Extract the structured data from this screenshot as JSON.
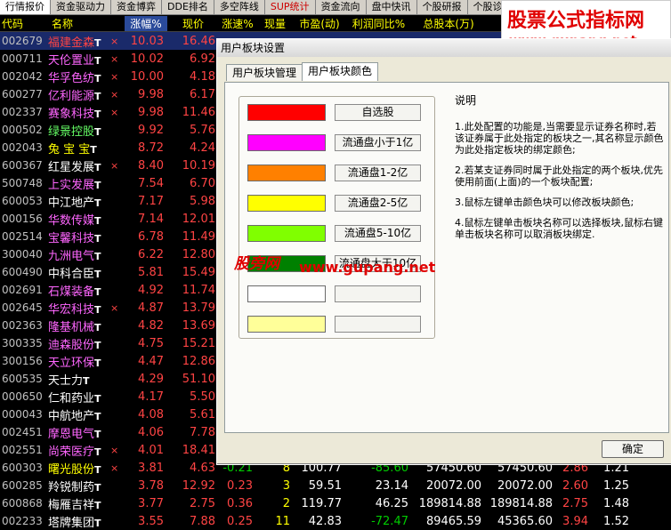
{
  "tabs": [
    "行情报价",
    "资金驱动力",
    "资金博弈",
    "DDE排名",
    "多空阵线",
    "SUP统计",
    "资金流向",
    "盘中快讯",
    "个股研报",
    "个股诊断",
    "热点聚焦"
  ],
  "columns": {
    "code": "代码",
    "name": "名称",
    "pct": "涨幅%",
    "price": "现价",
    "speed": "涨速%",
    "vol": "现量",
    "pe": "市盈(动)",
    "profit": "利润同比%",
    "total": "总股本(万)"
  },
  "rows": [
    {
      "code": "002679",
      "name": "福建金森",
      "x": "×",
      "pct": "10.03",
      "price": "16.46"
    },
    {
      "code": "000711",
      "name": "天伦置业",
      "x": "×",
      "pct": "10.02",
      "price": "6.92"
    },
    {
      "code": "002042",
      "name": "华孚色纺",
      "x": "×",
      "pct": "10.00",
      "price": "4.18"
    },
    {
      "code": "600277",
      "name": "亿利能源",
      "x": "×",
      "pct": "9.98",
      "price": "6.17"
    },
    {
      "code": "002337",
      "name": "赛象科技",
      "x": "×",
      "pct": "9.98",
      "price": "11.46"
    },
    {
      "code": "000502",
      "name": "绿景控股",
      "x": "",
      "pct": "9.92",
      "price": "5.76"
    },
    {
      "code": "002043",
      "name": "兔 宝 宝",
      "x": "",
      "pct": "8.72",
      "price": "4.24"
    },
    {
      "code": "600367",
      "name": "红星发展",
      "x": "×",
      "pct": "8.40",
      "price": "10.19"
    },
    {
      "code": "500748",
      "name": "上实发展",
      "x": "",
      "pct": "7.54",
      "price": "6.70"
    },
    {
      "code": "600053",
      "name": "中江地产",
      "x": "",
      "pct": "7.17",
      "price": "5.98"
    },
    {
      "code": "000156",
      "name": "华数传媒",
      "x": "",
      "pct": "7.14",
      "price": "12.01"
    },
    {
      "code": "002514",
      "name": "宝馨科技",
      "x": "",
      "pct": "6.78",
      "price": "11.49"
    },
    {
      "code": "300040",
      "name": "九洲电气",
      "x": "",
      "pct": "6.22",
      "price": "12.80"
    },
    {
      "code": "600490",
      "name": "中科合臣",
      "x": "",
      "pct": "5.81",
      "price": "15.49"
    },
    {
      "code": "002691",
      "name": "石煤装备",
      "x": "",
      "pct": "4.92",
      "price": "11.74"
    },
    {
      "code": "002645",
      "name": "华宏科技",
      "x": "×",
      "pct": "4.87",
      "price": "13.79"
    },
    {
      "code": "002363",
      "name": "隆基机械",
      "x": "",
      "pct": "4.82",
      "price": "13.69"
    },
    {
      "code": "300335",
      "name": "迪森股份",
      "x": "",
      "pct": "4.75",
      "price": "15.21"
    },
    {
      "code": "300156",
      "name": "天立环保",
      "x": "",
      "pct": "4.47",
      "price": "12.86"
    },
    {
      "code": "600535",
      "name": "天士力",
      "x": "",
      "pct": "4.29",
      "price": "51.10"
    },
    {
      "code": "000650",
      "name": "仁和药业",
      "x": "",
      "pct": "4.17",
      "price": "5.50"
    },
    {
      "code": "000043",
      "name": "中航地产",
      "x": "",
      "pct": "4.08",
      "price": "5.61"
    },
    {
      "code": "002451",
      "name": "摩恩电气",
      "x": "",
      "pct": "4.06",
      "price": "7.78"
    },
    {
      "code": "002551",
      "name": "尚荣医疗",
      "x": "×",
      "pct": "4.01",
      "price": "18.41"
    },
    {
      "code": "600303",
      "name": "曙光股份",
      "x": "×",
      "pct": "3.81",
      "price": "4.63",
      "speed": "-0.21",
      "vol": "8",
      "pe": "100.77",
      "profit": "-85.60",
      "total": "57450.60",
      "float": "57450.60",
      "x1": "2.86",
      "x2": "1.21"
    },
    {
      "code": "600285",
      "name": "羚锐制药",
      "x": "",
      "pct": "3.78",
      "price": "12.92",
      "speed": "0.23",
      "vol": "3",
      "pe": "59.51",
      "profit": "23.14",
      "total": "20072.00",
      "float": "20072.00",
      "x1": "2.60",
      "x2": "1.25"
    },
    {
      "code": "600868",
      "name": "梅雁吉祥",
      "x": "",
      "pct": "3.77",
      "price": "2.75",
      "speed": "0.36",
      "vol": "2",
      "pe": "119.77",
      "profit": "46.25",
      "total": "189814.88",
      "float": "189814.88",
      "x1": "2.75",
      "x2": "1.48"
    },
    {
      "code": "002233",
      "name": "塔牌集团",
      "x": "",
      "pct": "3.55",
      "price": "7.88",
      "speed": "0.25",
      "vol": "11",
      "pe": "42.83",
      "profit": "-72.47",
      "total": "89465.59",
      "float": "45365.60",
      "x1": "3.94",
      "x2": "1.52"
    }
  ],
  "dialog": {
    "title": "用户板块设置",
    "tabs": [
      "用户板块管理",
      "用户板块颜色"
    ],
    "blocks": [
      {
        "color": "#ff0000",
        "label": "自选股"
      },
      {
        "color": "#ff00ff",
        "label": "流通盘小于1亿"
      },
      {
        "color": "#ff8000",
        "label": "流通盘1-2亿"
      },
      {
        "color": "#ffff00",
        "label": "流通盘2-5亿"
      },
      {
        "color": "#80ff00",
        "label": "流通盘5-10亿"
      },
      {
        "color": "#008000",
        "label": "流通盘大于10亿"
      },
      {
        "color": "#ffffff",
        "label": ""
      },
      {
        "color": "#ffff99",
        "label": ""
      }
    ],
    "desc_title": "说明",
    "desc": [
      "1.此处配置的功能是,当需要显示证券名称时,若该证券属于此处指定的板块之一,其名称显示颜色为此处指定板块的绑定颜色;",
      "2.若某支证券同时属于此处指定的两个板块,优先使用前面(上面)的一个板块配置;",
      "3.鼠标左键单击颜色块可以修改板块颜色;",
      "4.鼠标左键单击板块名称可以选择板块,鼠标右键单击板块名称可以取消板块绑定."
    ],
    "ok_label": "确定"
  },
  "logo": {
    "line1": "股票公式指标网",
    "line2": "www.gupang.net"
  },
  "watermark": {
    "text1": "股旁网",
    "text2": "www.gupang.net"
  }
}
